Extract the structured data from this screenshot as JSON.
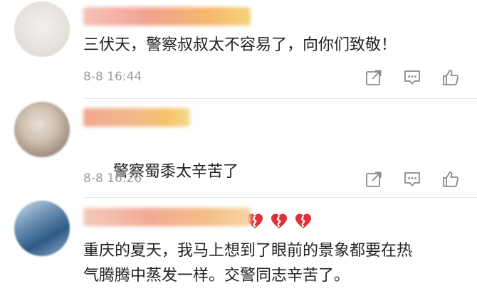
{
  "comments": [
    {
      "text": "三伏天，警察叔叔太不容易了，向你们致敬！",
      "time": "8-8 16:44",
      "emoji": []
    },
    {
      "text": "警察蜀黍太辛苦了",
      "time": "8-8 16:26",
      "emoji": [
        "broken-heart",
        "broken-heart",
        "broken-heart"
      ]
    },
    {
      "text": "重庆的夏天，我马上想到了眼前的景象都要在热\n气腾腾中蒸发一样。交警同志辛苦了。",
      "time": "",
      "emoji": []
    }
  ],
  "actions": [
    "share-icon",
    "reply-icon",
    "like-icon"
  ],
  "colors": {
    "text": "#222222",
    "meta": "#9c9c9c",
    "icon": "#8a8a8a",
    "heart": "#e0303a",
    "divider": "#e8e8e8"
  }
}
